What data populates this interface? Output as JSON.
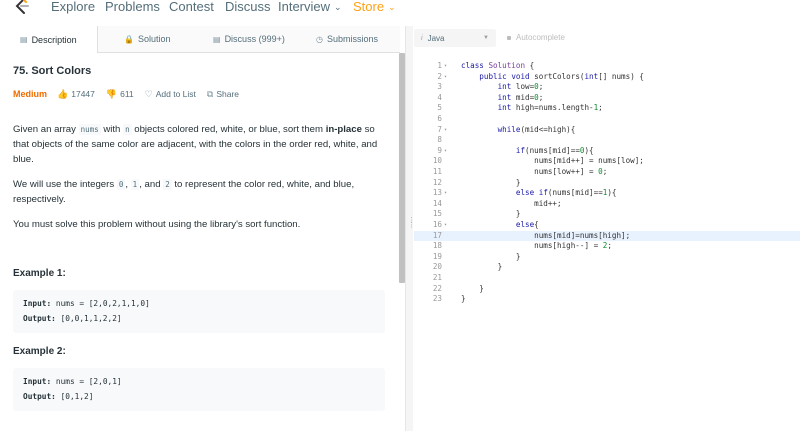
{
  "nav": {
    "items": [
      {
        "label": "Explore"
      },
      {
        "label": "Problems"
      },
      {
        "label": "Contest"
      },
      {
        "label": "Discuss"
      },
      {
        "label": "Interview"
      },
      {
        "label": "Store"
      }
    ]
  },
  "tabs": [
    {
      "label": "Description",
      "icon": "document-icon"
    },
    {
      "label": "Solution",
      "icon": "lock-icon"
    },
    {
      "label": "Discuss (999+)",
      "icon": "comment-icon"
    },
    {
      "label": "Submissions",
      "icon": "clock-icon"
    }
  ],
  "problem": {
    "title": "75. Sort Colors",
    "difficulty": "Medium",
    "likes": "17447",
    "dislikes": "611",
    "add_to_list": "Add to List",
    "share": "Share",
    "p1_a": "Given an array ",
    "p1_code": "nums",
    "p1_b": " with ",
    "p1_code2": "n",
    "p1_c": " objects colored red, white, or blue, sort them ",
    "p1_link": "in-place",
    "p1_d": " so that objects of the same color are adjacent, with the colors in the order red, white, and blue.",
    "p2_a": "We will use the integers ",
    "p2_c0": "0",
    "p2_sep1": ", ",
    "p2_c1": "1",
    "p2_sep2": ", and ",
    "p2_c2": "2",
    "p2_b": " to represent the color red, white, and blue, respectively.",
    "p3": "You must solve this problem without using the library's sort function."
  },
  "examples": [
    {
      "heading": "Example 1:",
      "input_label": "Input:",
      "input": "nums = [2,0,2,1,1,0]",
      "output_label": "Output:",
      "output": "[0,0,1,1,2,2]"
    },
    {
      "heading": "Example 2:",
      "input_label": "Input:",
      "input": "nums = [2,0,1]",
      "output_label": "Output:",
      "output": "[0,1,2]"
    }
  ],
  "editor": {
    "language": "Java",
    "autocomplete": "Autocomplete",
    "highlighted_line": 17,
    "lines": [
      {
        "n": "1",
        "fold": true,
        "code": "class Solution {"
      },
      {
        "n": "2",
        "fold": true,
        "code": "    public void sortColors(int[] nums) {"
      },
      {
        "n": "3",
        "fold": false,
        "code": "        int low=0;"
      },
      {
        "n": "4",
        "fold": false,
        "code": "        int mid=0;"
      },
      {
        "n": "5",
        "fold": false,
        "code": "        int high=nums.length-1;"
      },
      {
        "n": "6",
        "fold": false,
        "code": ""
      },
      {
        "n": "7",
        "fold": true,
        "code": "        while(mid<=high){"
      },
      {
        "n": "8",
        "fold": false,
        "code": ""
      },
      {
        "n": "9",
        "fold": true,
        "code": "            if(nums[mid]==0){"
      },
      {
        "n": "10",
        "fold": false,
        "code": "                nums[mid++] = nums[low];"
      },
      {
        "n": "11",
        "fold": false,
        "code": "                nums[low++] = 0;"
      },
      {
        "n": "12",
        "fold": false,
        "code": "            }"
      },
      {
        "n": "13",
        "fold": true,
        "code": "            else if(nums[mid]==1){"
      },
      {
        "n": "14",
        "fold": false,
        "code": "                mid++;"
      },
      {
        "n": "15",
        "fold": false,
        "code": "            }"
      },
      {
        "n": "16",
        "fold": true,
        "code": "            else{"
      },
      {
        "n": "17",
        "fold": false,
        "code": "                nums[mid]=nums[high];"
      },
      {
        "n": "18",
        "fold": false,
        "code": "                nums[high--] = 2;"
      },
      {
        "n": "19",
        "fold": false,
        "code": "            }"
      },
      {
        "n": "20",
        "fold": false,
        "code": "        }"
      },
      {
        "n": "21",
        "fold": false,
        "code": ""
      },
      {
        "n": "22",
        "fold": false,
        "code": "    }"
      },
      {
        "n": "23",
        "fold": false,
        "code": "}"
      }
    ]
  },
  "colors": {
    "accent": "#ffa116",
    "difficulty": "#ef6c00",
    "highlight": "#e8f2ff"
  }
}
